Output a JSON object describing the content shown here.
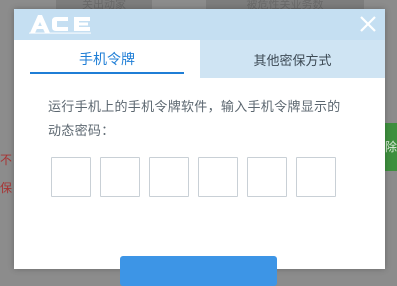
{
  "background": {
    "tabs": [
      {
        "label": "关出动家"
      },
      {
        "label": "被危性关业务数"
      }
    ],
    "left_fragments": [
      "不",
      "保"
    ],
    "right_fragment": "除"
  },
  "modal": {
    "logo": "ACE",
    "tabs": [
      {
        "label": "手机令牌",
        "active": true
      },
      {
        "label": "其他密保方式",
        "active": false
      }
    ],
    "instruction": "运行手机上的手机令牌软件，输入手机令牌显示的动态密码：",
    "code_inputs": [
      "",
      "",
      "",
      "",
      "",
      ""
    ],
    "submit_label": ""
  },
  "colors": {
    "accent": "#1f7ed6",
    "header_bg": "#c5dff2",
    "inactive_tab_bg": "#cfe4f3",
    "button": "#3d95e6",
    "overlay": "#8c8c8c"
  },
  "icons": {
    "logo": "ace-logo-icon",
    "close": "close-icon"
  }
}
